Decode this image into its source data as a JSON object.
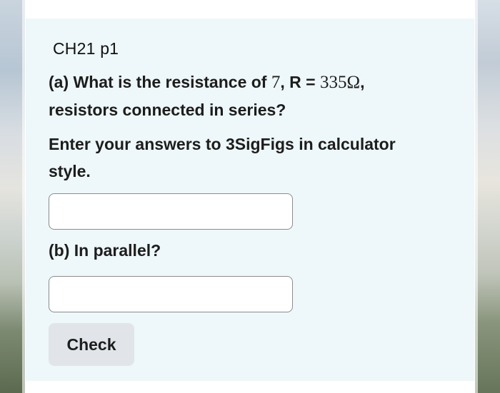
{
  "question": {
    "title": "CH21 p1",
    "part_a_prefix": "(a) What is the resistance of ",
    "part_a_count": "7",
    "part_a_mid": ", R = ",
    "part_a_resistance": "335Ω",
    "part_a_suffix": ",",
    "part_a_line2": "resistors connected in series?",
    "instructions_line1": "Enter your answers to 3SigFigs in calculator",
    "instructions_line2": "style.",
    "part_b": "(b) In parallel?"
  },
  "inputs": {
    "answer_a_value": "",
    "answer_b_value": ""
  },
  "actions": {
    "check_label": "Check"
  }
}
